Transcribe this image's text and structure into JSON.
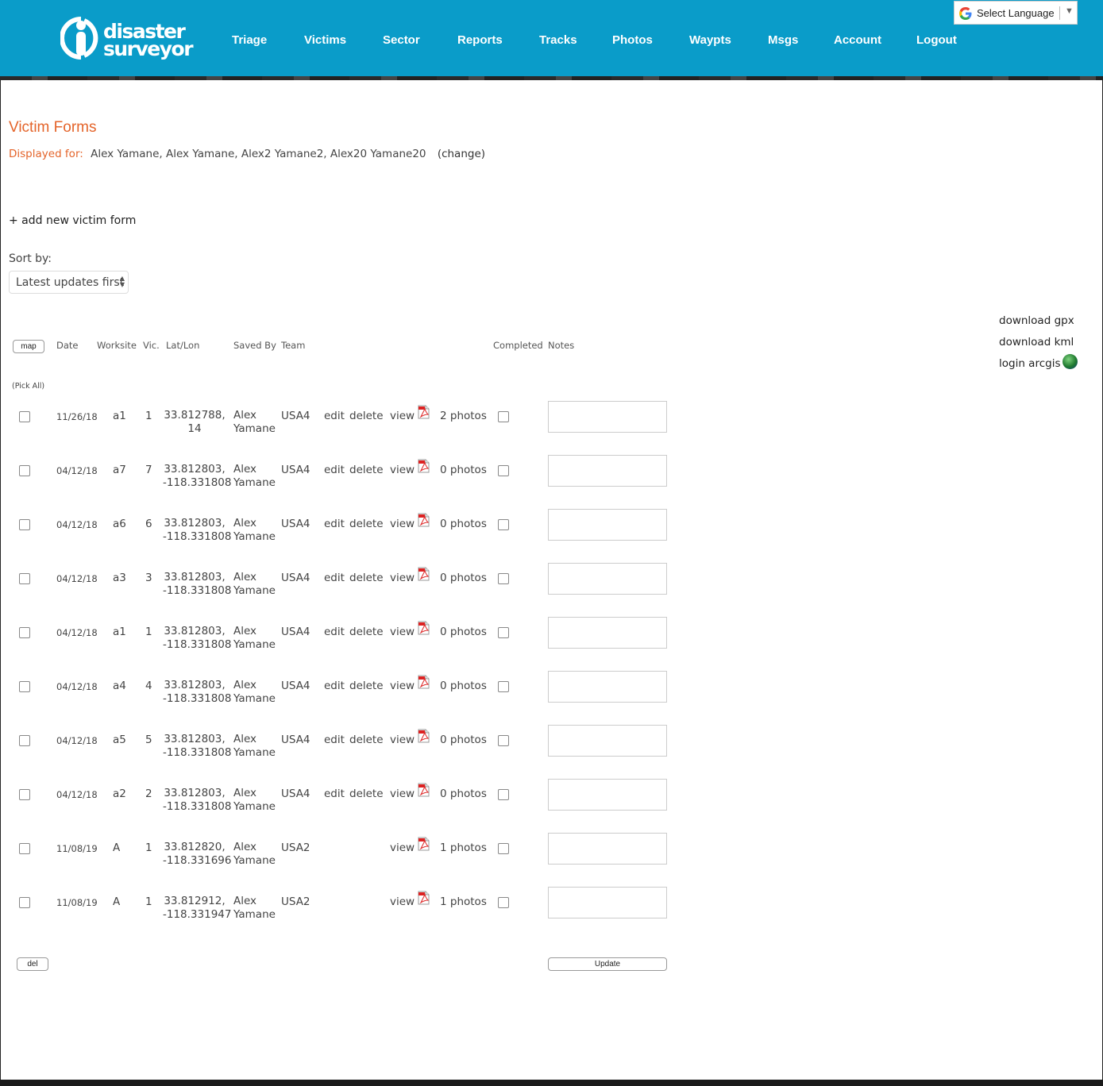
{
  "header": {
    "brand_line1": "disaster",
    "brand_line2": "surveyor",
    "nav": [
      "Triage",
      "Victims",
      "Sector",
      "Reports",
      "Tracks",
      "Photos",
      "Waypts",
      "Msgs",
      "Account",
      "Logout"
    ],
    "language_label": "Select Language",
    "brand_color": "#0a9cc9"
  },
  "page": {
    "title": "Victim Forms",
    "displayed_for_label": "Displayed for:",
    "displayed_for_names": "Alex Yamane, Alex Yamane, Alex2 Yamane2, Alex20 Yamane20",
    "change_label": "(change)",
    "add_new": "+ add new victim form",
    "sort_label": "Sort by:",
    "sort_value": "Latest updates first",
    "accent_color": "#e4642a"
  },
  "downloads": {
    "gpx": "download gpx",
    "kml": "download kml",
    "arcgis": "login arcgis"
  },
  "table": {
    "map_button": "map",
    "pick_all": "(Pick All)",
    "headers": {
      "date": "Date",
      "worksite": "Worksite",
      "vic": "Vic.",
      "latlon": "Lat/Lon",
      "saved_by": "Saved By",
      "team": "Team",
      "completed": "Completed",
      "notes": "Notes"
    },
    "edit_label": "edit",
    "delete_label": "delete",
    "view_label": "view",
    "rows": [
      {
        "date": "11/26/18",
        "worksite": "a1",
        "vic": "1",
        "lat": "33.812788,",
        "lon": "14",
        "first": "Alex",
        "last": "Yamane",
        "team": "USA4",
        "photos": "2 photos",
        "editable": true
      },
      {
        "date": "04/12/18",
        "worksite": "a7",
        "vic": "7",
        "lat": "33.812803,",
        "lon": "-118.331808",
        "first": "Alex",
        "last": "Yamane",
        "team": "USA4",
        "photos": "0 photos",
        "editable": true
      },
      {
        "date": "04/12/18",
        "worksite": "a6",
        "vic": "6",
        "lat": "33.812803,",
        "lon": "-118.331808",
        "first": "Alex",
        "last": "Yamane",
        "team": "USA4",
        "photos": "0 photos",
        "editable": true
      },
      {
        "date": "04/12/18",
        "worksite": "a3",
        "vic": "3",
        "lat": "33.812803,",
        "lon": "-118.331808",
        "first": "Alex",
        "last": "Yamane",
        "team": "USA4",
        "photos": "0 photos",
        "editable": true
      },
      {
        "date": "04/12/18",
        "worksite": "a1",
        "vic": "1",
        "lat": "33.812803,",
        "lon": "-118.331808",
        "first": "Alex",
        "last": "Yamane",
        "team": "USA4",
        "photos": "0 photos",
        "editable": true
      },
      {
        "date": "04/12/18",
        "worksite": "a4",
        "vic": "4",
        "lat": "33.812803,",
        "lon": "-118.331808",
        "first": "Alex",
        "last": "Yamane",
        "team": "USA4",
        "photos": "0 photos",
        "editable": true
      },
      {
        "date": "04/12/18",
        "worksite": "a5",
        "vic": "5",
        "lat": "33.812803,",
        "lon": "-118.331808",
        "first": "Alex",
        "last": "Yamane",
        "team": "USA4",
        "photos": "0 photos",
        "editable": true
      },
      {
        "date": "04/12/18",
        "worksite": "a2",
        "vic": "2",
        "lat": "33.812803,",
        "lon": "-118.331808",
        "first": "Alex",
        "last": "Yamane",
        "team": "USA4",
        "photos": "0 photos",
        "editable": true
      },
      {
        "date": "11/08/19",
        "worksite": "A",
        "vic": "1",
        "lat": "33.812820,",
        "lon": "-118.331696",
        "first": "Alex",
        "last": "Yamane",
        "team": "USA2",
        "photos": "1 photos",
        "editable": false
      },
      {
        "date": "11/08/19",
        "worksite": "A",
        "vic": "1",
        "lat": "33.812912,",
        "lon": "-118.331947",
        "first": "Alex",
        "last": "Yamane",
        "team": "USA2",
        "photos": "1 photos",
        "editable": false
      }
    ],
    "del_button": "del",
    "update_button": "Update"
  }
}
